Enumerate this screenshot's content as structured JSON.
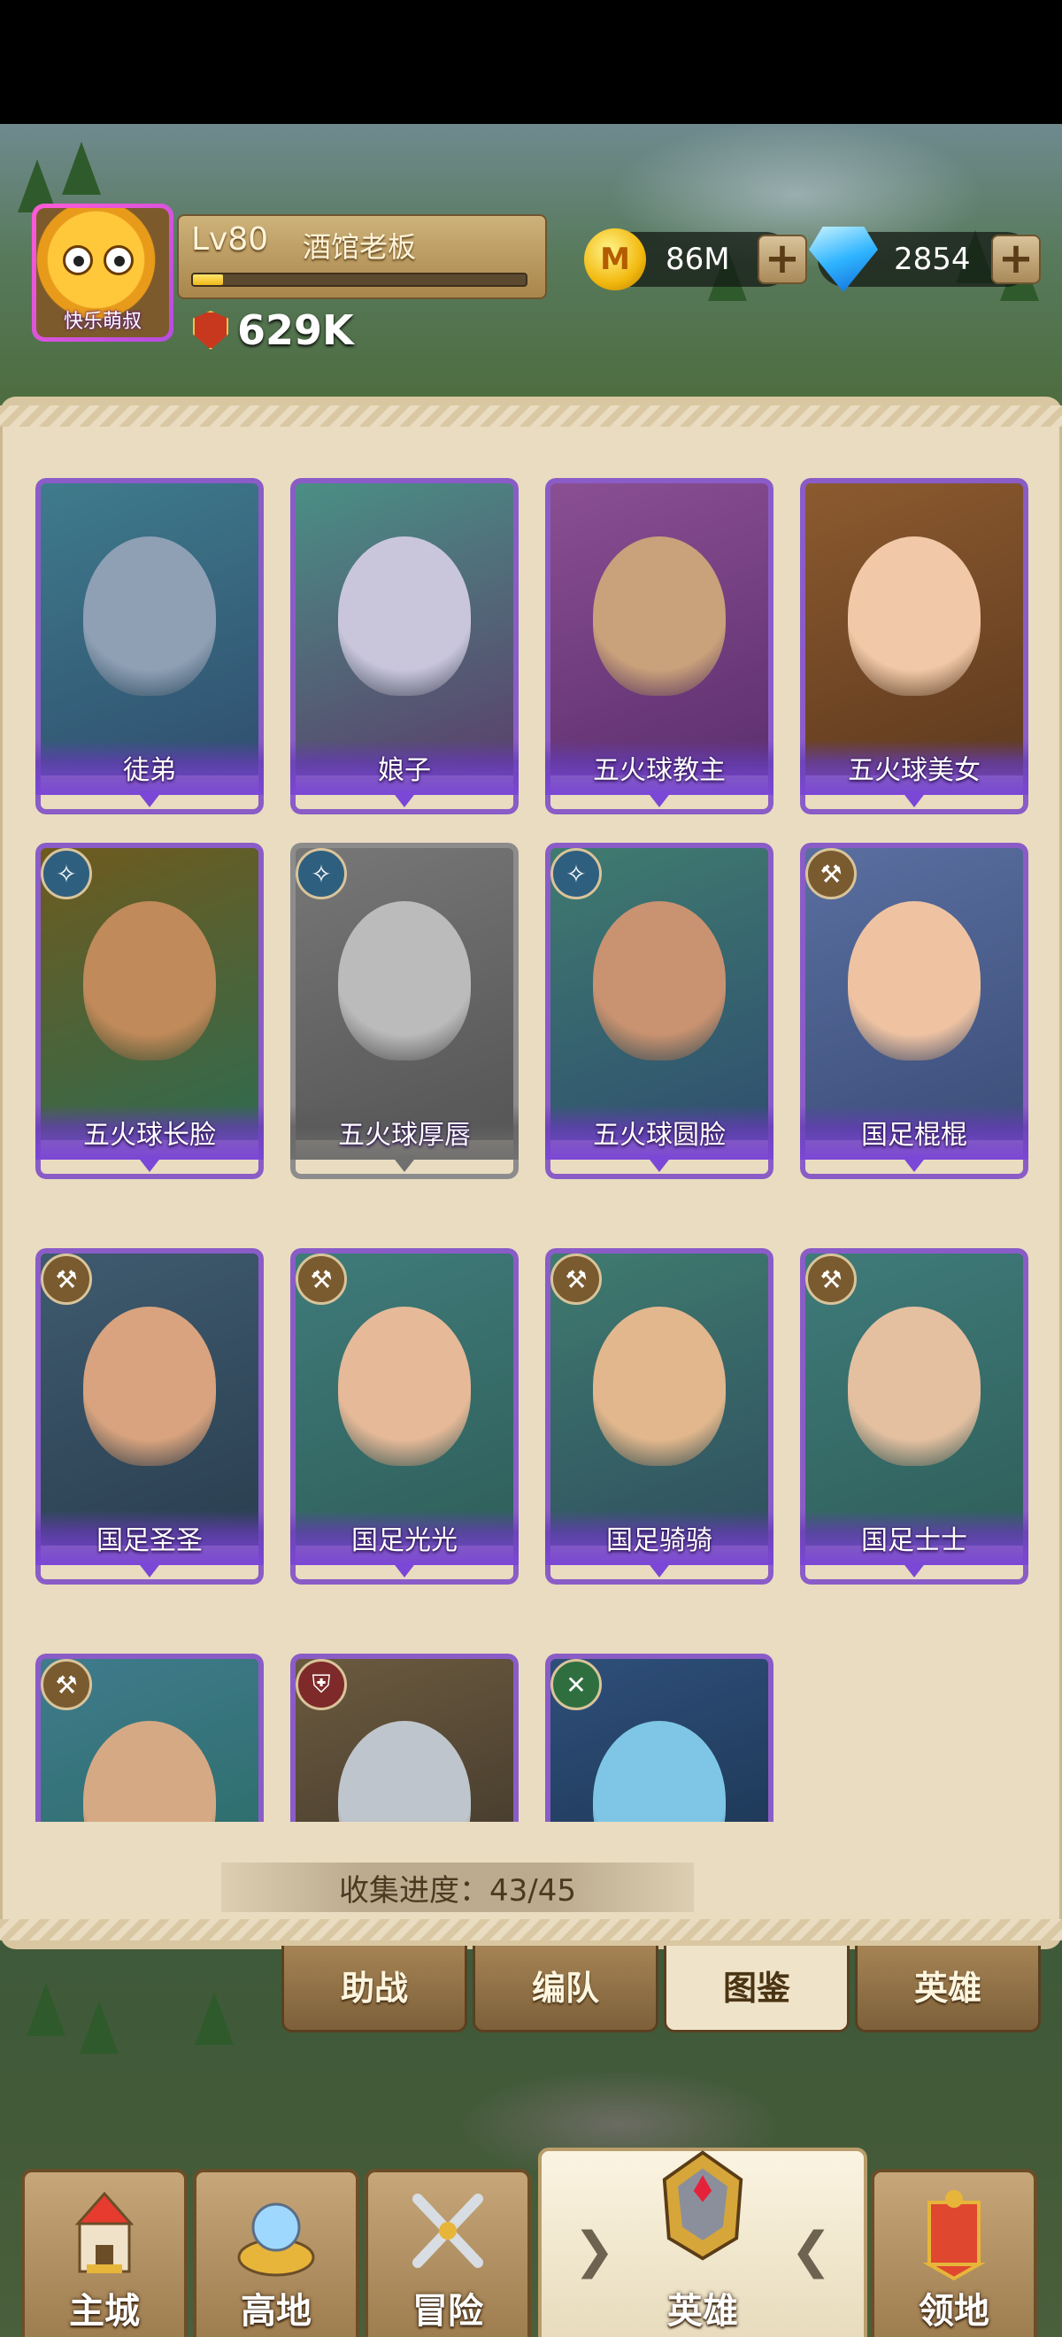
{
  "player": {
    "avatar_name": "快乐萌叔",
    "level": "Lv80",
    "title": "酒馆老板",
    "exp_fraction": 0.09,
    "power": "629K"
  },
  "currency": {
    "gold": "86M",
    "gold_symbol": "M",
    "gems": "2854",
    "plus": "+"
  },
  "heroes": [
    {
      "name": "徒弟",
      "class_icon": "",
      "state": "owned"
    },
    {
      "name": "娘子",
      "class_icon": "",
      "state": "owned"
    },
    {
      "name": "五火球教主",
      "class_icon": "",
      "state": "owned"
    },
    {
      "name": "五火球美女",
      "class_icon": "",
      "state": "owned"
    },
    {
      "name": "五火球长脸",
      "class_icon": "mage-staff-icon",
      "state": "owned"
    },
    {
      "name": "五火球厚唇",
      "class_icon": "mage-staff-icon",
      "state": "locked"
    },
    {
      "name": "五火球圆脸",
      "class_icon": "mage-staff-icon",
      "state": "owned"
    },
    {
      "name": "国足棍棍",
      "class_icon": "warrior-axe-icon",
      "state": "owned"
    },
    {
      "name": "国足圣圣",
      "class_icon": "warrior-axe-icon",
      "state": "owned"
    },
    {
      "name": "国足光光",
      "class_icon": "warrior-axe-icon",
      "state": "owned"
    },
    {
      "name": "国足骑骑",
      "class_icon": "warrior-axe-icon",
      "state": "owned"
    },
    {
      "name": "国足士士",
      "class_icon": "warrior-axe-icon",
      "state": "owned"
    },
    {
      "name": "",
      "class_icon": "warrior-axe-icon",
      "state": "partial"
    },
    {
      "name": "",
      "class_icon": "tank-shield-icon",
      "state": "partial"
    },
    {
      "name": "",
      "class_icon": "support-cross-icon",
      "state": "partial"
    }
  ],
  "collection": {
    "label": "收集进度：43/45"
  },
  "subtabs": [
    {
      "label": "助战",
      "active": false
    },
    {
      "label": "编队",
      "active": false
    },
    {
      "label": "图鉴",
      "active": true
    },
    {
      "label": "英雄",
      "active": false
    }
  ],
  "bottom_nav": [
    {
      "label": "主城",
      "icon": "castle-icon"
    },
    {
      "label": "高地",
      "icon": "highland-icon"
    },
    {
      "label": "冒险",
      "icon": "crossed-swords-icon"
    },
    {
      "label": "英雄",
      "icon": "hero-helmet-icon",
      "active": true
    },
    {
      "label": "领地",
      "icon": "territory-banner-icon"
    }
  ],
  "colors": {
    "card_frame_owned": "#8a5cc7",
    "card_frame_locked": "#8c8c8c",
    "panel_bg": "#e9dcc0",
    "tab_bg": "#a58354"
  }
}
